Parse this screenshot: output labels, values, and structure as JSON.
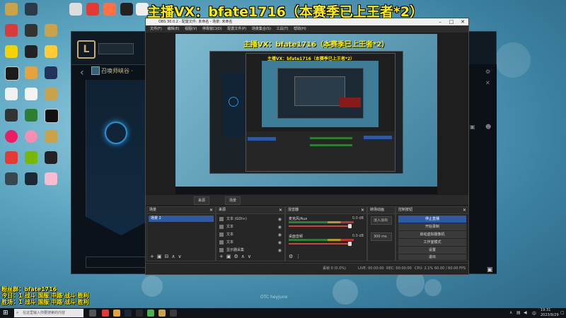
{
  "banner": {
    "text": "主播VX：bfate1716（本赛季已上王者*2）",
    "color": "#ffee00"
  },
  "lol_client": {
    "logo": "L",
    "play_label": "",
    "mode_label": "召唤师峡谷 ·"
  },
  "obs": {
    "title": "OBS 30.0.2 - 配置文件: 未命名 - 场景: 未命名",
    "menu": [
      "文件(F)",
      "编辑(E)",
      "视图(V)",
      "停靠窗口(D)",
      "配置文件(P)",
      "场景集合(S)",
      "工具(T)",
      "帮助(H)"
    ],
    "tabs": [
      "来源",
      "场景"
    ],
    "scenes": {
      "header": "场景",
      "items": [
        "场景 2"
      ],
      "selected": "场景 2"
    },
    "sources": {
      "header": "来源",
      "items": [
        "文本 (GDI+)",
        "文本",
        "文本",
        "文本",
        "显示器采集"
      ]
    },
    "mixer": {
      "header": "混音器",
      "channels": [
        {
          "name": "麦克风/Aux",
          "db": "0.0 dB"
        },
        {
          "name": "桌面音频",
          "db": "0.0 dB"
        }
      ]
    },
    "transitions": {
      "header": "转场动画",
      "type": "淡入淡出",
      "duration": "300 ms"
    },
    "controls": {
      "header": "控制按钮",
      "buttons": [
        "停止直播",
        "开始录制",
        "启动虚拟摄像机",
        "工作室模式",
        "设置",
        "退出"
      ]
    },
    "status": [
      "丢帧 0 (0.0%)",
      "LIVE: 00:00:00",
      "REC: 00:00:00",
      "CPU: 2.1%",
      "60.00 / 60.00 FPS"
    ]
  },
  "stream_info": {
    "lines": [
      "粉丝群：bfate1716",
      "今日：1 战斗 国服 中路 战斗 胜利",
      "胜场：1 战斗 国服 中路 战斗 胜利"
    ]
  },
  "watermark": "OTC heyjune",
  "taskbar": {
    "search_placeholder": "在这里输入你要搜索的内容",
    "clock_time": "19:31",
    "clock_date": "2023/9/29",
    "lang": "中"
  },
  "colors": {
    "accent": "#2e59a4",
    "banner": "#ffee00",
    "obs_bg": "#1e1e1e"
  }
}
